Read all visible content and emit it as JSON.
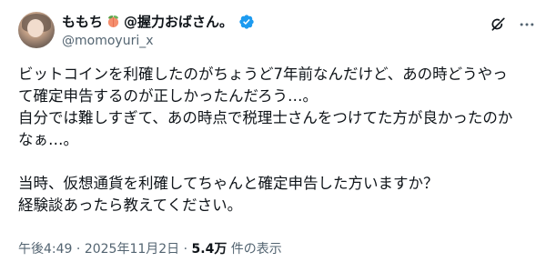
{
  "author": {
    "display_name": "ももち",
    "display_name_suffix": "@握力おばさん。",
    "handle": "@momoyuri_x",
    "name_emoji": "peach-icon",
    "verified_icon": "verified-badge-icon",
    "verified_color": "#1d9bf0"
  },
  "actions": {
    "grok_icon": "grok-icon",
    "more_icon": "more-icon"
  },
  "tweet": {
    "lines": [
      "ビットコインを利確したのがちょうど7年前なんだけど、あの時どうやっ",
      "て確定申告するのが正しかったんだろう…。",
      "自分では難しすぎて、あの時点で税理士さんをつけてた方が良かったのか",
      "なぁ…。",
      "",
      "当時、仮想通貨を利確してちゃんと確定申告した方いますか？",
      "経験談あったら教えてください。"
    ]
  },
  "meta": {
    "time": "午後4:49",
    "separator": " · ",
    "date": "2025年11月2日",
    "views_count": "5.4万",
    "views_label": " 件の表示"
  }
}
